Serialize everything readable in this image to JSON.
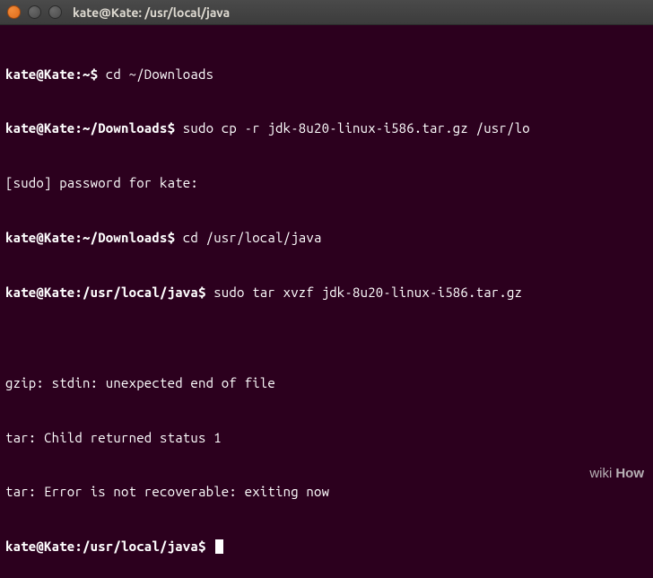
{
  "window": {
    "title": "kate@Kate: /usr/local/java"
  },
  "terminal": {
    "lines": [
      {
        "prompt": "kate@Kate:~$",
        "command": " cd ~/Downloads"
      },
      {
        "prompt": "kate@Kate:~/Downloads$",
        "command": " sudo cp -r jdk-8u20-linux-i586.tar.gz /usr/lo"
      },
      {
        "prompt": "",
        "command": "[sudo] password for kate:"
      },
      {
        "prompt": "kate@Kate:~/Downloads$",
        "command": " cd /usr/local/java"
      },
      {
        "prompt": "kate@Kate:/usr/local/java$",
        "command": " sudo tar xvzf jdk-8u20-linux-i586.tar.gz"
      },
      {
        "prompt": "",
        "command": ""
      },
      {
        "prompt": "",
        "command": "gzip: stdin: unexpected end of file"
      },
      {
        "prompt": "",
        "command": "tar: Child returned status 1"
      },
      {
        "prompt": "",
        "command": "tar: Error is not recoverable: exiting now"
      },
      {
        "prompt": "kate@Kate:/usr/local/java$",
        "command": " ",
        "cursor": true
      }
    ]
  },
  "watermark": {
    "prefix": "wiki",
    "suffix": "How"
  }
}
